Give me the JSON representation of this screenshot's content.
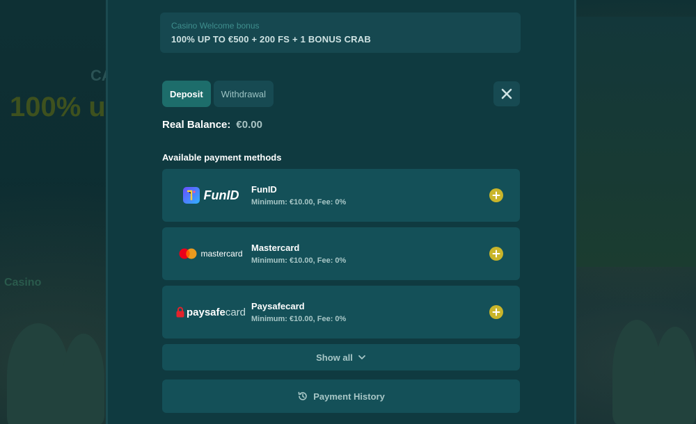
{
  "backdrop": {
    "headline_fragment": "100% u",
    "ca_fragment": "CA",
    "casino_fragment": "Casino"
  },
  "bonus": {
    "label": "Casino Welcome bonus",
    "title": "100% UP TO €500 + 200 FS + 1 BONUS CRAB"
  },
  "tabs": [
    {
      "label": "Deposit",
      "active": true
    },
    {
      "label": "Withdrawal",
      "active": false
    }
  ],
  "close": {
    "icon": "close-icon"
  },
  "balance": {
    "label": "Real Balance:",
    "value": "€0.00"
  },
  "payment_methods": {
    "title": "Available payment methods",
    "items": [
      {
        "name": "FunID",
        "logo_text": "FunID",
        "desc": "Minimum: €10.00, Fee: 0%"
      },
      {
        "name": "Mastercard",
        "logo_text": "mastercard",
        "desc": "Minimum: €10.00, Fee: 0%"
      },
      {
        "name": "Paysafecard",
        "logo_text_a": "paysafe",
        "logo_text_b": "card",
        "desc": "Minimum: €10.00, Fee: 0%"
      }
    ]
  },
  "show_all": {
    "label": "Show all",
    "icon": "chevron-down-icon"
  },
  "history": {
    "label": "Payment History",
    "icon": "history-icon"
  },
  "colors": {
    "accent": "#1d6d6b",
    "plus": "#c9b52a",
    "panel": "#0f3a40"
  }
}
